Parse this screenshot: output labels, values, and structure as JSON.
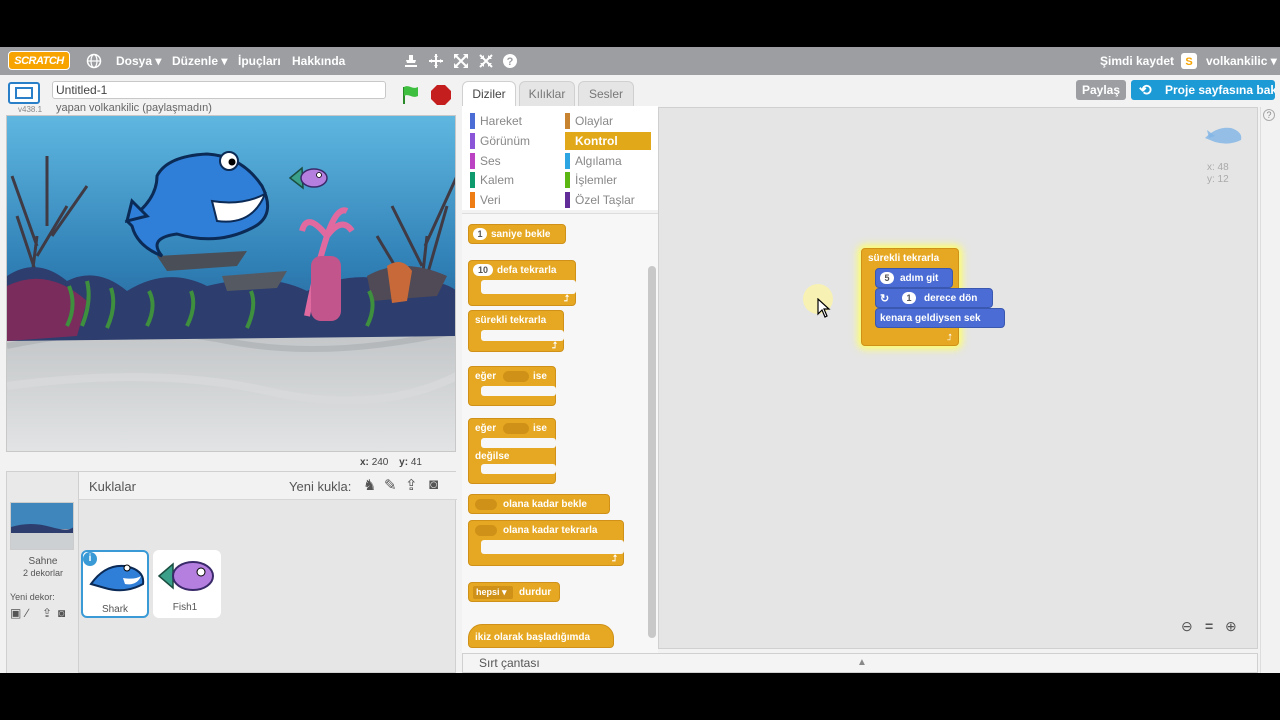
{
  "menu": {
    "logo": "SCRATCH",
    "file": "Dosya ▾",
    "edit": "Düzenle ▾",
    "tips": "İpuçları",
    "about": "Hakkında",
    "save_now": "Şimdi kaydet",
    "username": "volkankilic ▾"
  },
  "project": {
    "title_value": "Untitled-1",
    "author_line": "yapan volkankilic (paylaşmadın)",
    "version": "v438.1"
  },
  "buttons": {
    "share": "Paylaş",
    "see_project_page": "Proje sayfasına bak"
  },
  "stage": {
    "coords_x_label": "x:",
    "coords_x": "240",
    "coords_y_label": "y:",
    "coords_y": "41"
  },
  "sprites": {
    "header": "Kuklalar",
    "new_sprite": "Yeni kukla:",
    "stage_label": "Sahne",
    "stage_backdrops": "2 dekorlar",
    "new_backdrop": "Yeni dekor:",
    "items": [
      {
        "name": "Shark"
      },
      {
        "name": "Fish1"
      }
    ]
  },
  "tabs": [
    "Diziler",
    "Kılıklar",
    "Sesler"
  ],
  "categories": [
    {
      "label": "Hareket",
      "color": "#4a6cd4"
    },
    {
      "label": "Görünüm",
      "color": "#8a55d7"
    },
    {
      "label": "Ses",
      "color": "#bb42c3"
    },
    {
      "label": "Kalem",
      "color": "#0e9a6c"
    },
    {
      "label": "Veri",
      "color": "#ee7d16"
    },
    {
      "label": "Olaylar",
      "color": "#c88330"
    },
    {
      "label": "Kontrol",
      "color": "#e1a91a"
    },
    {
      "label": "Algılama",
      "color": "#2ca5e2"
    },
    {
      "label": "İşlemler",
      "color": "#5cb712"
    },
    {
      "label": "Özel Taşlar",
      "color": "#632d99"
    }
  ],
  "palette": {
    "wait": "saniye bekle",
    "wait_val": "1",
    "repeat": "defa tekrarla",
    "repeat_val": "10",
    "forever": "sürekli tekrarla",
    "if_a": "eğer",
    "if_b": "ise",
    "ifelse_a": "eğer",
    "ifelse_b": "ise",
    "else": "değilse",
    "wait_until": "olana kadar bekle",
    "repeat_until": "olana kadar tekrarla",
    "stop_val": "hepsi ▾",
    "stop": "durdur",
    "clone_start": "ikiz olarak başladığımda"
  },
  "script": {
    "forever": "sürekli tekrarla",
    "move_val": "5",
    "move": "adım git",
    "turn_val": "1",
    "turn": "derece dön",
    "bounce": "kenara geldiysen sek"
  },
  "scripts_area": {
    "sprite_x": "x: 48",
    "sprite_y": "y: 12"
  },
  "backpack": "Sırt çantası"
}
